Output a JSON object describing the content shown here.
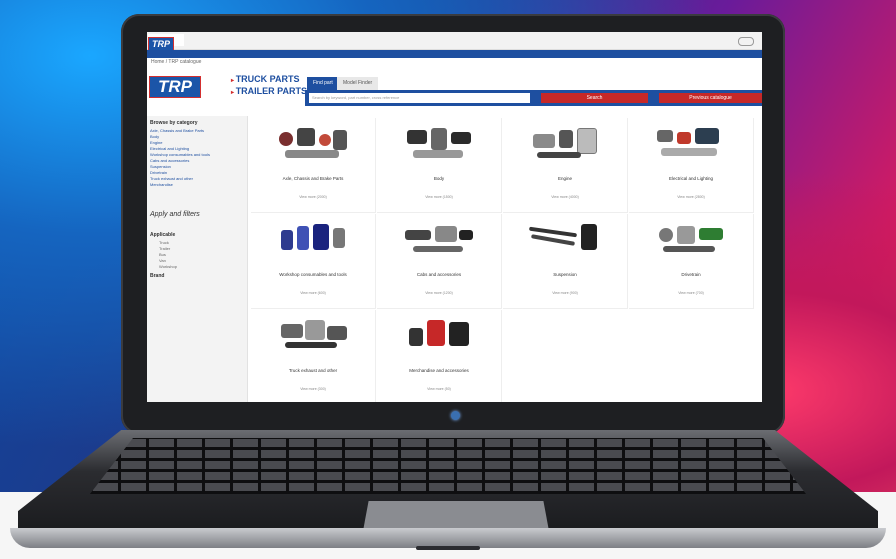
{
  "site": {
    "logo_text": "TRP",
    "brand_lines": [
      "TRUCK PARTS",
      "TRAILER PARTS"
    ],
    "tabs": [
      "Find part",
      "Model Finder"
    ],
    "search_placeholder": "Search by keyword, part number, cross reference",
    "search_button": "Search",
    "prev_button": "Previous catalogue",
    "breadcrumb": "Home / TRP catalogue",
    "colors": {
      "brand_blue": "#1e4fa0",
      "brand_red": "#c62828"
    }
  },
  "sidebar": {
    "browse_title": "Browse by category",
    "items": [
      "Axle, Chassis and Brake Parts",
      "Body",
      "Engine",
      "Electrical and Lighting",
      "Workshop consumables and tools",
      "Cabs and accessories",
      "Suspension",
      "Drivetrain",
      "Truck exhaust and other",
      "Merchandise"
    ],
    "apply_label": "Apply and filters",
    "filter_title": "Applicable",
    "filter_items": [
      "Truck",
      "Trailer",
      "Bus",
      "Van",
      "Workshop"
    ],
    "brand_title": "Brand"
  },
  "categories": [
    {
      "title": "Axle, Chassis and Brake Parts",
      "link": "View more (2000)"
    },
    {
      "title": "Body",
      "link": "View more (1500)"
    },
    {
      "title": "Engine",
      "link": "View more (4000)"
    },
    {
      "title": "Electrical and Lighting",
      "link": "View more (2800)"
    },
    {
      "title": "Workshop consumables and tools",
      "link": "View more (600)"
    },
    {
      "title": "Cabs and accessories",
      "link": "View more (1200)"
    },
    {
      "title": "Suspension",
      "link": "View more (900)"
    },
    {
      "title": "Drivetrain",
      "link": "View more (700)"
    },
    {
      "title": "Truck exhaust and other",
      "link": "View more (300)"
    },
    {
      "title": "Merchandise and accessories",
      "link": "View more (50)"
    }
  ]
}
